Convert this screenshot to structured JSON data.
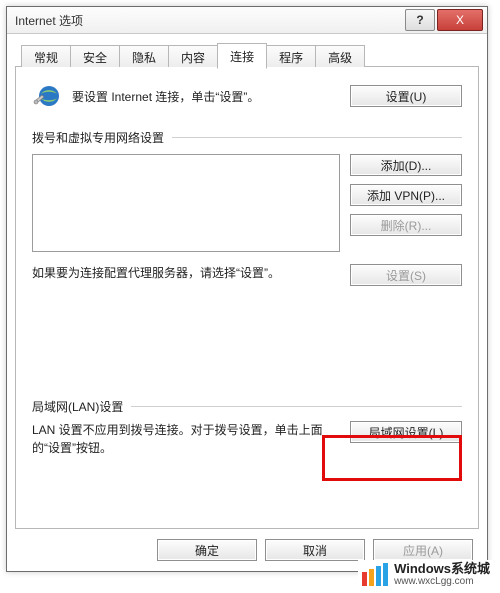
{
  "window": {
    "title": "Internet 选项",
    "help": "?",
    "close": "X"
  },
  "tabs": [
    {
      "label": "常规"
    },
    {
      "label": "安全"
    },
    {
      "label": "隐私"
    },
    {
      "label": "内容"
    },
    {
      "label": "连接",
      "active": true
    },
    {
      "label": "程序"
    },
    {
      "label": "高级"
    }
  ],
  "setup": {
    "text": "要设置 Internet 连接，单击“设置”。",
    "button": "设置(U)"
  },
  "dialup": {
    "group_label": "拨号和虚拟专用网络设置",
    "add": "添加(D)...",
    "add_vpn": "添加 VPN(P)...",
    "remove": "删除(R)...",
    "proxy_text": "如果要为连接配置代理服务器，请选择“设置”。",
    "settings": "设置(S)"
  },
  "lan": {
    "group_label": "局域网(LAN)设置",
    "text": "LAN 设置不应用到拨号连接。对于拨号设置，单击上面的“设置”按钮。",
    "button": "局域网设置(L)"
  },
  "footer": {
    "ok": "确定",
    "cancel": "取消",
    "apply": "应用(A)"
  },
  "watermark": {
    "bars": [
      "#e63b2e",
      "#f6a21b",
      "#2aa3e6",
      "#2aa3e6"
    ],
    "line1": "Windows系统城",
    "line2": "www.wxcLgg.com"
  }
}
